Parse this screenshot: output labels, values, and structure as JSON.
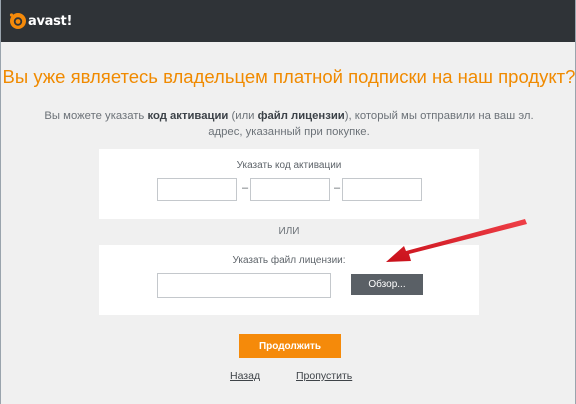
{
  "app": {
    "logo_text": "avast!"
  },
  "heading": "Вы уже являетесь владельцем платной подписки на наш продукт?",
  "subtext": {
    "part1": "Вы можете указать ",
    "bold1": "код активации",
    "part2": " (или ",
    "bold2": "файл лицензии",
    "part3": "), который мы отправили на ваш эл. адрес, указанный при покупке."
  },
  "activation": {
    "label": "Указать код активации",
    "fields": [
      "",
      "",
      ""
    ],
    "separator": "–"
  },
  "or_text": "ИЛИ",
  "license": {
    "label": "Указать файл лицензии:",
    "file_value": "",
    "browse_label": "Обзор..."
  },
  "buttons": {
    "continue_label": "Продолжить",
    "back_label": "Назад",
    "skip_label": "Пропустить"
  },
  "colors": {
    "accent": "#f08a00",
    "titlebar": "#2f3337",
    "button_dark": "#5a6066",
    "arrow": "#e0141e"
  },
  "icons": {
    "logo": "avast-logo-icon",
    "annotation": "red-arrow-icon"
  }
}
